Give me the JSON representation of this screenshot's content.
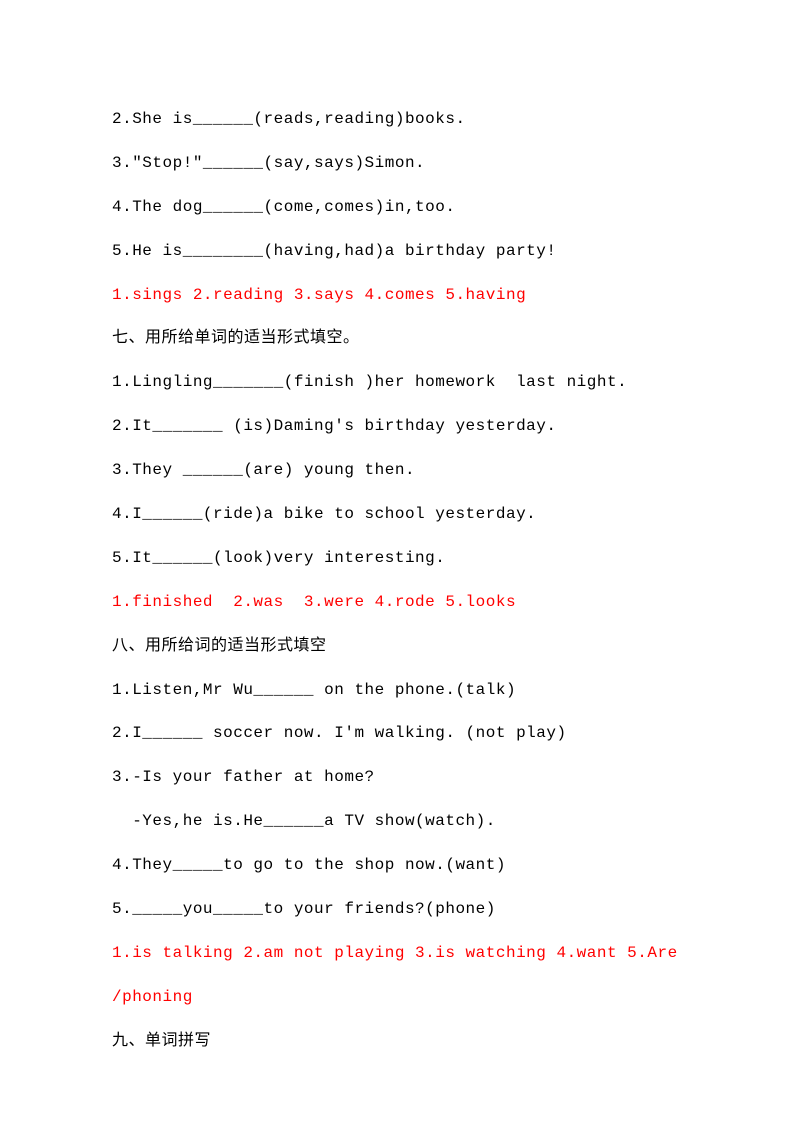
{
  "lines": [
    {
      "text": "2.She is______(reads,reading)books.",
      "cls": ""
    },
    {
      "text": "3.\"Stop!\"______(say,says)Simon.",
      "cls": ""
    },
    {
      "text": "4.The dog______(come,comes)in,too.",
      "cls": ""
    },
    {
      "text": "5.He is________(having,had)a birthday party!",
      "cls": ""
    },
    {
      "text": "1.sings 2.reading 3.says 4.comes 5.having",
      "cls": "answer"
    },
    {
      "text": "七、用所给单词的适当形式填空。",
      "cls": "section"
    },
    {
      "text": "1.Lingling_______(finish )her homework  last night.",
      "cls": ""
    },
    {
      "text": "2.It_______ (is)Daming's birthday yesterday.",
      "cls": ""
    },
    {
      "text": "3.They ______(are) young then.",
      "cls": ""
    },
    {
      "text": "4.I______(ride)a bike to school yesterday.",
      "cls": ""
    },
    {
      "text": "5.It______(look)very interesting.",
      "cls": ""
    },
    {
      "text": "1.finished  2.was  3.were 4.rode 5.looks",
      "cls": "answer"
    },
    {
      "text": "八、用所给词的适当形式填空",
      "cls": "section"
    },
    {
      "text": "1.Listen,Mr Wu______ on the phone.(talk)",
      "cls": ""
    },
    {
      "text": "2.I______ soccer now. I'm walking. (not play)",
      "cls": ""
    },
    {
      "text": "3.-Is your father at home?",
      "cls": ""
    },
    {
      "text": "  -Yes,he is.He______a TV show(watch).",
      "cls": ""
    },
    {
      "text": "4.They_____to go to the shop now.(want)",
      "cls": ""
    },
    {
      "text": "5._____you_____to your friends?(phone)",
      "cls": ""
    },
    {
      "text": "1.is talking 2.am not playing 3.is watching 4.want 5.Are",
      "cls": "answer"
    },
    {
      "text": "/phoning",
      "cls": "answer"
    },
    {
      "text": "九、单词拼写",
      "cls": "section"
    }
  ]
}
